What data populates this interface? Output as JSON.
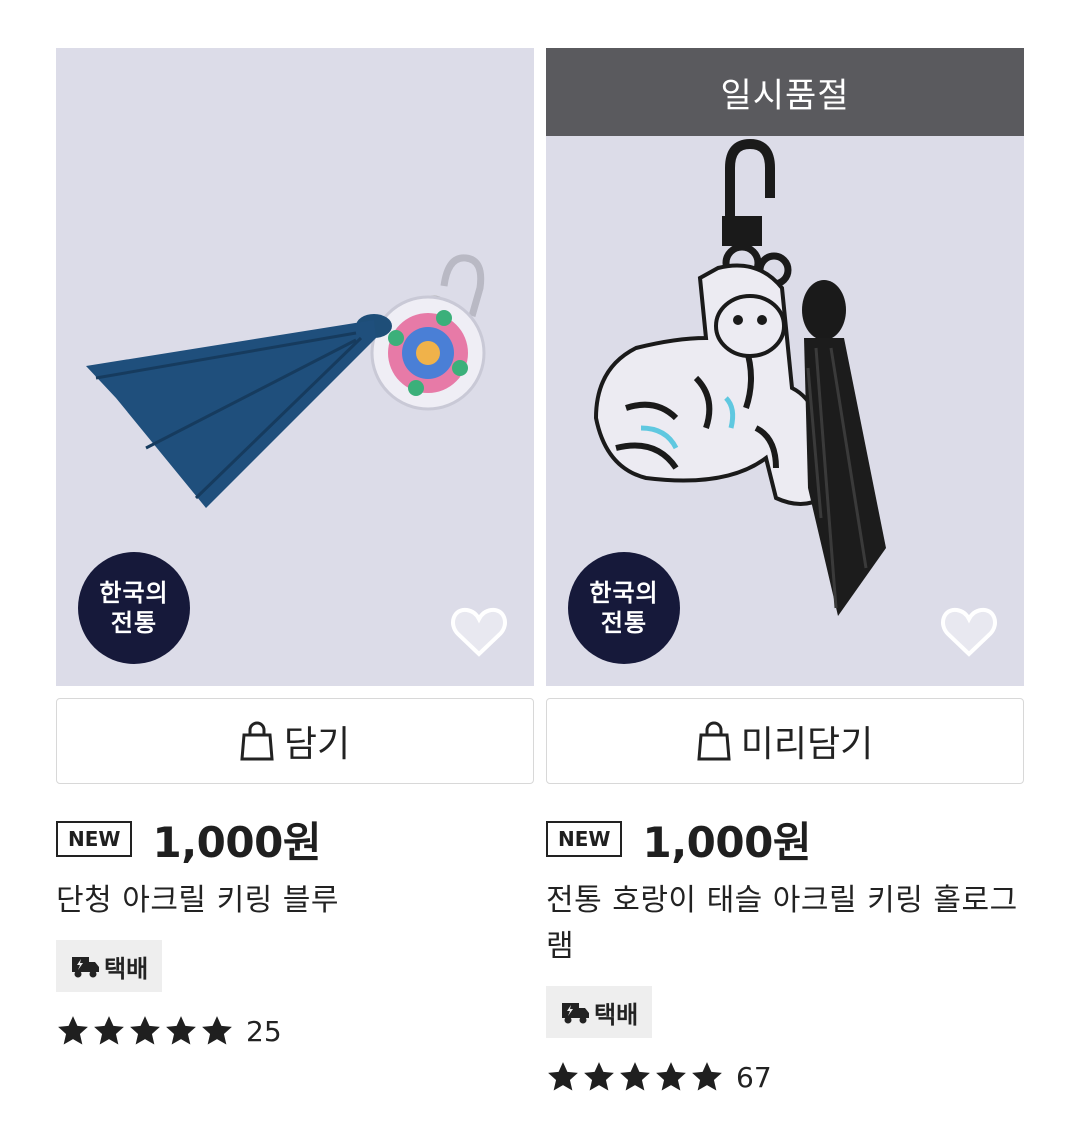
{
  "products": [
    {
      "sold_out": false,
      "brand_badge": [
        "한국의",
        "전통"
      ],
      "cart_label": "담기",
      "new_label": "NEW",
      "price": "1,000원",
      "title": "단청 아크릴 키링 블루",
      "shipping_label": "택배",
      "rating": 5,
      "review_count": "25"
    },
    {
      "sold_out": true,
      "sold_out_label": "일시품절",
      "brand_badge": [
        "한국의",
        "전통"
      ],
      "cart_label": "미리담기",
      "new_label": "NEW",
      "price": "1,000원",
      "title": "전통 호랑이 태슬 아크릴 키링 홀로그램",
      "shipping_label": "택배",
      "rating": 5,
      "review_count": "67"
    }
  ],
  "colors": {
    "image_bg": "#dcdce8",
    "soldout_bar": "#5a5a5e",
    "badge_bg": "#16193a",
    "star": "#1f1f1f"
  }
}
